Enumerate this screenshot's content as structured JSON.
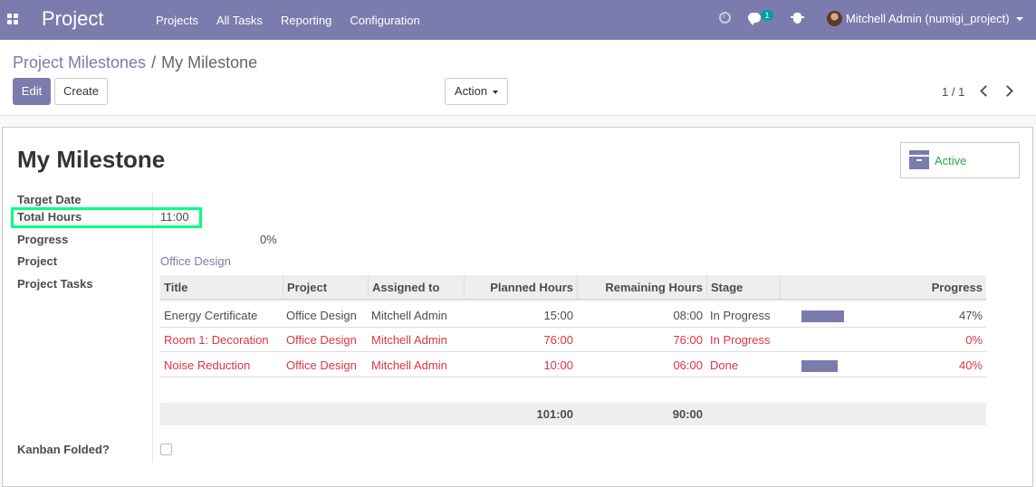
{
  "navbar": {
    "app_title": "Project",
    "menu": [
      "Projects",
      "All Tasks",
      "Reporting",
      "Configuration"
    ],
    "chat_count": "1",
    "user_name": "Mitchell Admin (numigi_project)",
    "icons": [
      "apps-icon",
      "clock-icon",
      "chat-icon",
      "bug-icon"
    ]
  },
  "breadcrumb": {
    "parent": "Project Milestones",
    "separator": "/",
    "current": "My Milestone"
  },
  "buttons": {
    "edit": "Edit",
    "create": "Create",
    "action": "Action"
  },
  "pager": {
    "value": "1 / 1"
  },
  "form": {
    "title": "My Milestone",
    "active_label": "Active",
    "fields": {
      "target_date_label": "Target Date",
      "target_date_value": "",
      "total_hours_label": "Total Hours",
      "total_hours_value": "11:00",
      "progress_label": "Progress",
      "progress_value": "0%",
      "project_label": "Project",
      "project_value": "Office Design",
      "tasks_label": "Project Tasks",
      "kanban_label": "Kanban Folded?"
    }
  },
  "tasks": {
    "columns": [
      "Title",
      "Project",
      "Assigned to",
      "Planned Hours",
      "Remaining Hours",
      "Stage",
      "Progress"
    ],
    "rows": [
      {
        "title": "Energy Certificate",
        "project": "Office Design",
        "assigned": "Mitchell Admin",
        "planned": "15:00",
        "remaining": "08:00",
        "stage": "In Progress",
        "progress": "47%",
        "progress_fraction": 0.47,
        "overdue": false
      },
      {
        "title": "Room 1: Decoration",
        "project": "Office Design",
        "assigned": "Mitchell Admin",
        "planned": "76:00",
        "remaining": "76:00",
        "stage": "In Progress",
        "progress": "0%",
        "progress_fraction": 0.0,
        "overdue": true
      },
      {
        "title": "Noise Reduction",
        "project": "Office Design",
        "assigned": "Mitchell Admin",
        "planned": "10:00",
        "remaining": "06:00",
        "stage": "Done",
        "progress": "40%",
        "progress_fraction": 0.4,
        "overdue": true
      }
    ],
    "totals": {
      "planned": "101:00",
      "remaining": "90:00"
    }
  },
  "colors": {
    "brand": "#7c7bad",
    "danger": "#dc3545",
    "active": "#28a745",
    "highlight": "#00ff7f"
  }
}
